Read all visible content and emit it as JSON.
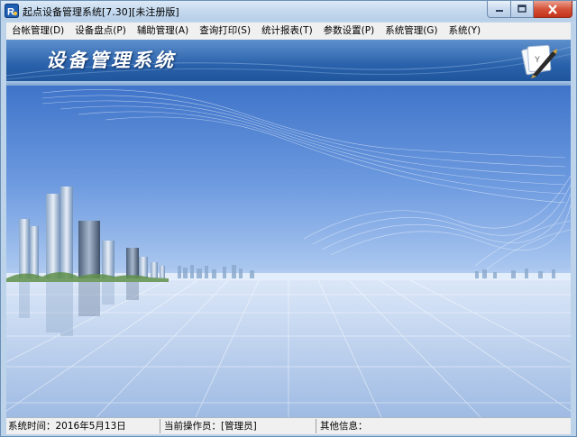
{
  "window": {
    "title": "起点设备管理系统[7.30][未注册版]",
    "icon": "app-logo-icon"
  },
  "caption_buttons": {
    "minimize_icon": "minimize-icon",
    "maximize_icon": "maximize-icon",
    "close_icon": "close-icon"
  },
  "menu": [
    {
      "label": "台帐管理(D)"
    },
    {
      "label": "设备盘点(P)"
    },
    {
      "label": "辅助管理(A)"
    },
    {
      "label": "查询打印(S)"
    },
    {
      "label": "统计报表(T)"
    },
    {
      "label": "参数设置(P)"
    },
    {
      "label": "系统管理(G)"
    },
    {
      "label": "系统(Y)"
    }
  ],
  "banner": {
    "title": "设备管理系统",
    "logo_icon": "pen-and-paper-icon"
  },
  "status": {
    "time_label": "系统时间：2016年5月13日",
    "operator_label": "当前操作员：[管理员]",
    "info_label": "其他信息："
  },
  "colors": {
    "banner": "#2a62ab",
    "close_button": "#d5533a",
    "sky": "#6e9be0"
  }
}
